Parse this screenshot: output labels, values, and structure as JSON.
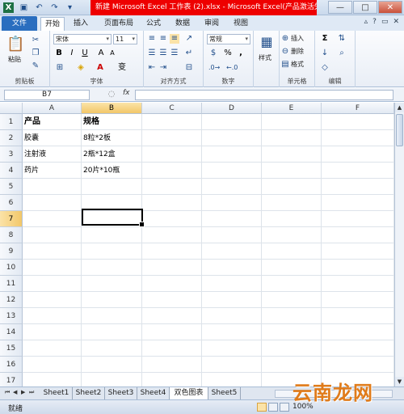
{
  "window": {
    "title": "新建 Microsoft Excel 工作表 (2).xlsx  -  Microsoft Excel(产品激活失败)",
    "controls": [
      "—",
      "□",
      "✕"
    ]
  },
  "ribbon_tabs": [
    {
      "label": "文件"
    },
    {
      "label": "开始"
    },
    {
      "label": "插入"
    },
    {
      "label": "页面布局"
    },
    {
      "label": "公式"
    },
    {
      "label": "数据"
    },
    {
      "label": "审阅"
    },
    {
      "label": "视图"
    }
  ],
  "ribbon": {
    "clipboard": {
      "paste": "粘贴",
      "label": "剪贴板"
    },
    "font": {
      "name": "宋体",
      "size": "11",
      "label": "字体",
      "bold": "B",
      "italic": "I",
      "underline": "U",
      "grow": "A",
      "shrink": "A",
      "font_color": "A",
      "wen": "变"
    },
    "alignment": {
      "label": "对齐方式"
    },
    "number": {
      "format": "常规",
      "label": "数字",
      "percent": "%",
      "comma": ","
    },
    "styles": {
      "label": "样式"
    },
    "cells": {
      "insert": "插入",
      "delete": "删除",
      "format": "格式",
      "label": "单元格"
    },
    "editing": {
      "sum": "Σ",
      "label": "编辑"
    }
  },
  "formula_bar": {
    "name_box": "B7",
    "fx": "fx",
    "value": ""
  },
  "columns": [
    "A",
    "B",
    "C",
    "D",
    "E",
    "F"
  ],
  "rows": [
    "1",
    "2",
    "3",
    "4",
    "5",
    "6",
    "7",
    "8",
    "9",
    "10",
    "11",
    "12",
    "13",
    "14",
    "15",
    "16",
    "17"
  ],
  "cells": {
    "A1": "产品",
    "B1": "规格",
    "A2": "胶囊",
    "B2": "8粒*2板",
    "A3": "注射液",
    "B3": "2瓶*12盒",
    "A4": "药片",
    "B4": "20片*10瓶"
  },
  "selected_cell": "B7",
  "sheets": [
    {
      "label": "Sheet1"
    },
    {
      "label": "Sheet2"
    },
    {
      "label": "Sheet3"
    },
    {
      "label": "Sheet4"
    },
    {
      "label": "双色图表"
    },
    {
      "label": "Sheet5"
    }
  ],
  "status": {
    "text": "就绪",
    "zoom": "100%"
  },
  "watermark": "云南龙网",
  "colors": {
    "accent": "#2a6ebf",
    "title_alert": "#e00000",
    "selected_header": "#f2c769"
  }
}
